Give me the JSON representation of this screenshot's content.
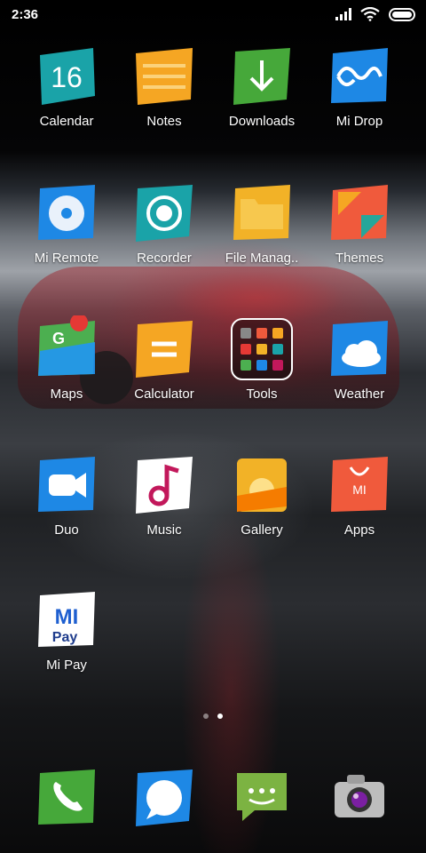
{
  "status_bar": {
    "time": "2:36"
  },
  "apps": [
    {
      "id": "calendar",
      "label": "Calendar",
      "date": "16"
    },
    {
      "id": "notes",
      "label": "Notes"
    },
    {
      "id": "downloads",
      "label": "Downloads"
    },
    {
      "id": "mi-drop",
      "label": "Mi Drop"
    },
    {
      "id": "mi-remote",
      "label": "Mi Remote"
    },
    {
      "id": "recorder",
      "label": "Recorder"
    },
    {
      "id": "file-manager",
      "label": "File Manag.."
    },
    {
      "id": "themes",
      "label": "Themes"
    },
    {
      "id": "maps",
      "label": "Maps"
    },
    {
      "id": "calculator",
      "label": "Calculator"
    },
    {
      "id": "tools",
      "label": "Tools"
    },
    {
      "id": "weather",
      "label": "Weather"
    },
    {
      "id": "duo",
      "label": "Duo"
    },
    {
      "id": "music",
      "label": "Music"
    },
    {
      "id": "gallery",
      "label": "Gallery"
    },
    {
      "id": "apps",
      "label": "Apps",
      "logo": "MI"
    },
    {
      "id": "mi-pay",
      "label": "Mi Pay",
      "logo_top": "MI",
      "logo_bottom": "Pay"
    }
  ],
  "dock": [
    {
      "id": "phone",
      "icon": "phone-icon"
    },
    {
      "id": "messages",
      "icon": "chat-bubble-icon"
    },
    {
      "id": "sms",
      "icon": "sms-icon"
    },
    {
      "id": "camera",
      "icon": "camera-icon"
    }
  ],
  "pages": {
    "count": 2,
    "active": 1
  },
  "colors": {
    "teal": "#1aa3a8",
    "orange": "#f5a623",
    "green": "#46a83a",
    "blue": "#1e88e5",
    "red": "#f05a3c",
    "purple": "#c2185b",
    "yellow": "#f2b227"
  }
}
